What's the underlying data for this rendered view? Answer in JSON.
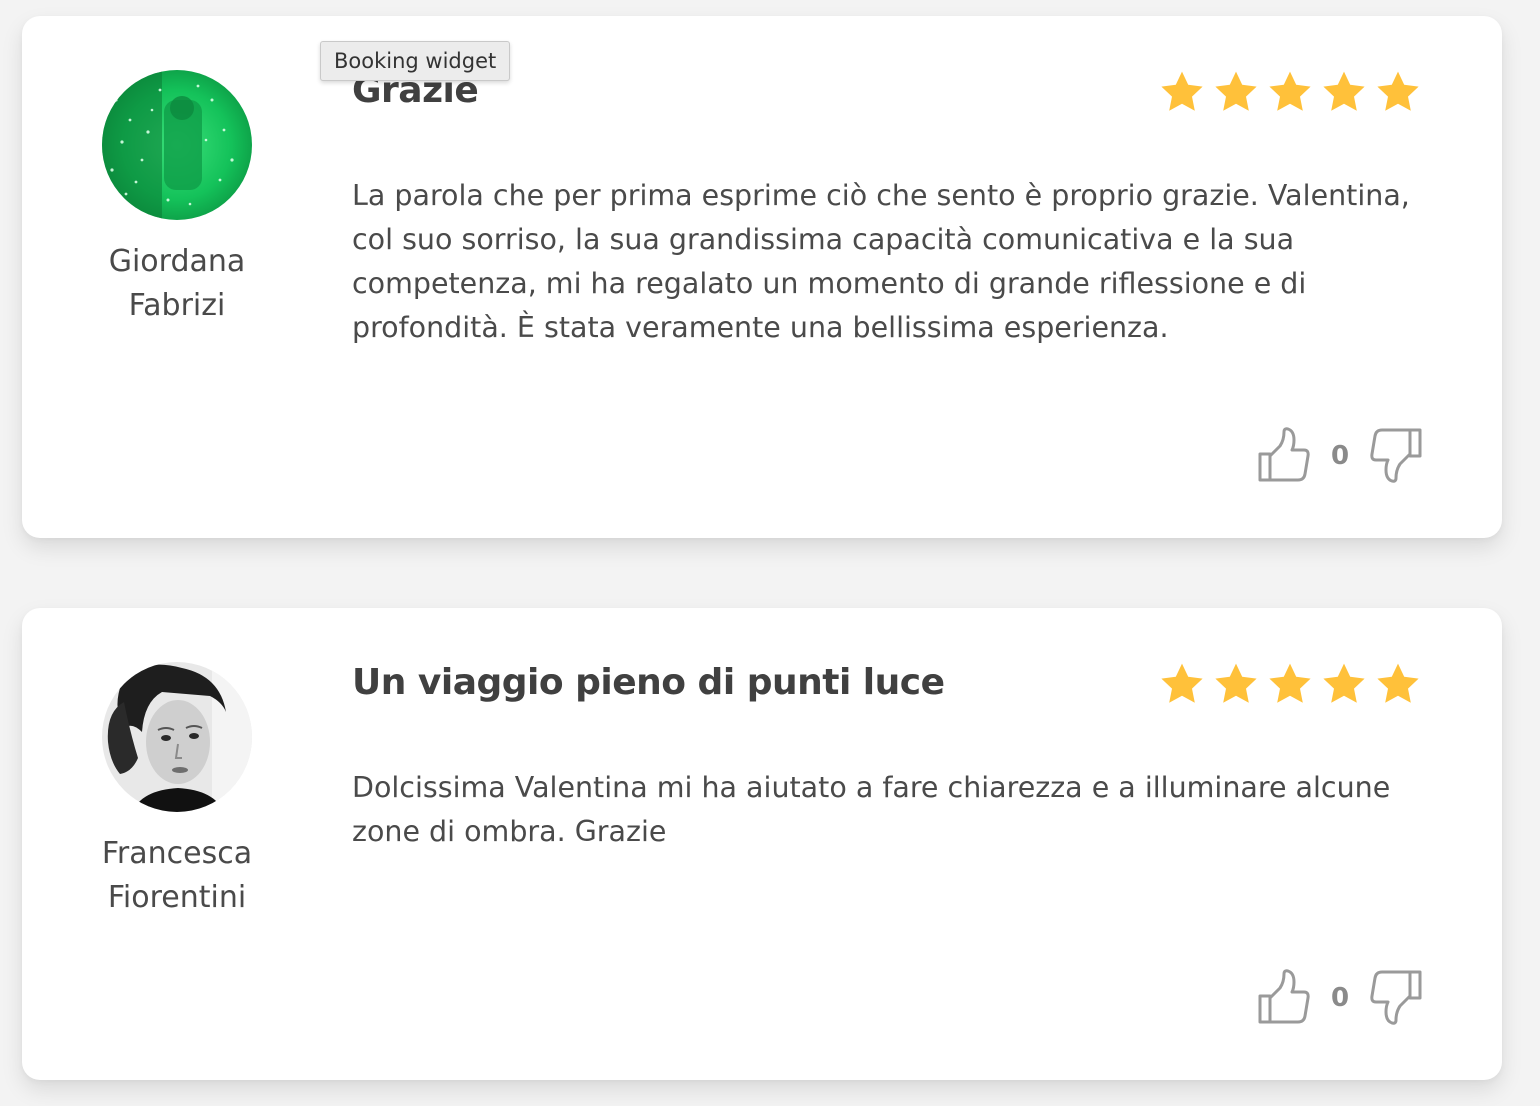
{
  "tooltip": "Booking widget",
  "colors": {
    "star": "#FFC13A",
    "vote_icon": "#9a9a9a",
    "card_bg": "#ffffff",
    "page_bg": "#f3f3f3"
  },
  "reviews": [
    {
      "author_first": "Giordana",
      "author_last": "Fabrizi",
      "title": "Grazie",
      "rating": 5,
      "text": "La parola che per prima esprime ciò che sento è proprio grazie. Valentina, col suo sorriso, la sua grandissima capacità comunicativa e la sua competenza, mi ha regalato un momento di grande riflessione e di profondità. È stata veramente una bellissima esperienza.",
      "votes": "0"
    },
    {
      "author_first": "Francesca",
      "author_last": "Fiorentini",
      "title": "Un viaggio pieno di punti luce",
      "rating": 5,
      "text": "Dolcissima Valentina mi ha aiutato a fare chiarezza e a illuminare alcune zone di ombra. Grazie",
      "votes": "0"
    }
  ]
}
